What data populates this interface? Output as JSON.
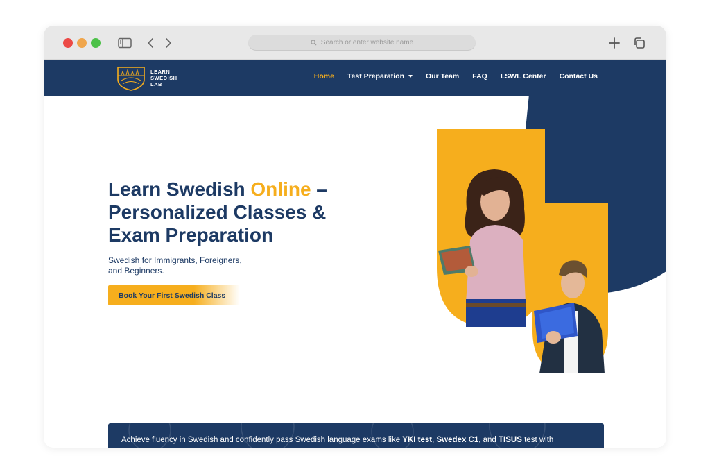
{
  "browser": {
    "search_placeholder": "Search or enter website name",
    "icons": [
      "sidebar-icon",
      "back-icon",
      "forward-icon",
      "search-icon",
      "new-tab-icon",
      "tabs-icon"
    ]
  },
  "colors": {
    "navy": "#1d3a64",
    "accent": "#f6ae1d"
  },
  "logo": {
    "line1": "LEARN",
    "line2": "SWEDISH",
    "line3": "LAB"
  },
  "nav": {
    "home": "Home",
    "test_prep": "Test Preparation",
    "team": "Our Team",
    "faq": "FAQ",
    "center": "LSWL Center",
    "contact": "Contact Us"
  },
  "hero": {
    "title_part1": "Learn Swedish ",
    "title_accent": "Online",
    "title_part2": " –",
    "title_line2": "Personalized Classes &",
    "title_line3": "Exam Preparation",
    "subtitle_line1": "Swedish for Immigrants, Foreigners,",
    "subtitle_line2": "and Beginners.",
    "cta": "Book Your First Swedish Class"
  },
  "banner": {
    "text_start": "Achieve fluency in Swedish and confidently pass Swedish language exams like ",
    "exam1": "YKI test",
    "sep1": ", ",
    "exam2": "Swedex C1",
    "sep2": ", and ",
    "exam3": "TISUS",
    "text_end": " test with"
  }
}
